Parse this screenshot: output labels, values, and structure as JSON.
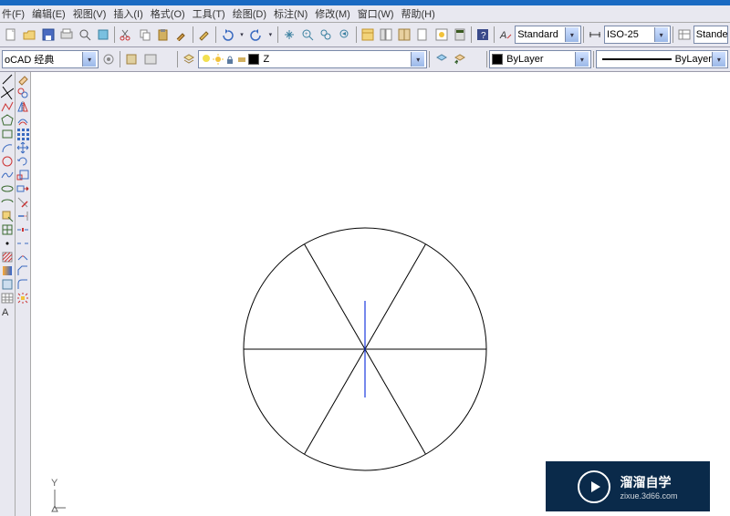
{
  "menu": {
    "file": "件(F)",
    "edit": "编辑(E)",
    "view": "视图(V)",
    "insert": "插入(I)",
    "format": "格式(O)",
    "tools": "工具(T)",
    "draw": "绘图(D)",
    "dim": "标注(N)",
    "modify": "修改(M)",
    "window": "窗口(W)",
    "help": "帮助(H)"
  },
  "workspace": "oCAD 经典",
  "text_style": {
    "label": "Standard"
  },
  "dim_style": {
    "label": "ISO-25"
  },
  "table_style": {
    "label": "Stande"
  },
  "layer": {
    "name": "Z",
    "color": "#000"
  },
  "props": {
    "bylayer_color": "ByLayer",
    "linetype": "ByLayer"
  },
  "watermark": {
    "title": "溜溜自学",
    "sub": "zixue.3d66.com"
  },
  "icons": {
    "sun": "#f2c23a",
    "bulb": "#f2c23a",
    "freeze": "#f2c23a",
    "lock": "#5a7aa0",
    "sq": "#000"
  },
  "ucs": {
    "y": "Y",
    "n": "△"
  }
}
